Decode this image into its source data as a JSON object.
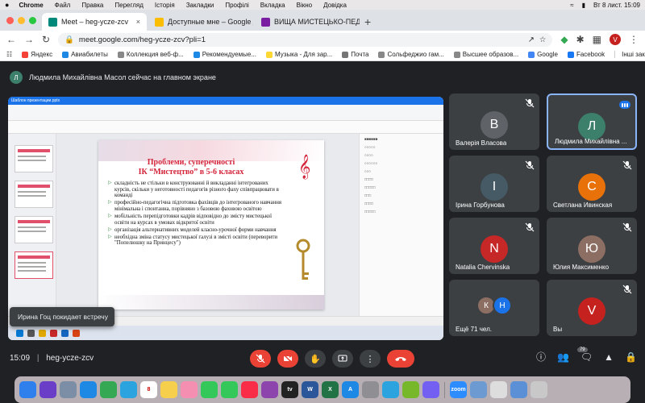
{
  "macbar": {
    "apple": "",
    "menus": [
      "Chrome",
      "Файл",
      "Правка",
      "Перегляд",
      "Історія",
      "Закладки",
      "Профілі",
      "Вкладка",
      "Вікно",
      "Довідка"
    ],
    "clock": "Вт 8 лист.  15:09"
  },
  "tabs": [
    {
      "title": "Meet – heg-ycze-zcv",
      "color": "#00897b",
      "active": true
    },
    {
      "title": "Доступные мне – Google Диск",
      "color": "#fbbc04",
      "active": false
    },
    {
      "title": "ВИЩА МИСТЕЦЬКО-ПЕДАГОГ...",
      "color": "#7b1fa2",
      "active": false
    }
  ],
  "address": {
    "url": "meet.google.com/heg-ycze-zcv?pli=1",
    "profile": "V"
  },
  "bookmarks": [
    {
      "label": "Яндекс",
      "color": "#f44336"
    },
    {
      "label": "Авиабилеты",
      "color": "#1e88e5"
    },
    {
      "label": "Коллекция веб-ф...",
      "color": "#888888"
    },
    {
      "label": "Рекомендуемые...",
      "color": "#1e88e5"
    },
    {
      "label": "Музыка - Для зар...",
      "color": "#fdd835"
    },
    {
      "label": "Почта",
      "color": "#757575"
    },
    {
      "label": "Сольфеджио гам...",
      "color": "#888888"
    },
    {
      "label": "Высшее образов...",
      "color": "#888888"
    },
    {
      "label": "Google",
      "color": "#4285f4"
    },
    {
      "label": "Facebook",
      "color": "#1877f2"
    }
  ],
  "bookmarks_other": "Інші закладки",
  "banner": {
    "initial": "Л",
    "text": "Людмила Михайлівна Масол сейчас на главном экране"
  },
  "slide": {
    "title_line1": "Проблеми, суперечності",
    "title_line2": "ІК “Мистецтво” в 5-6 класах",
    "bullets": [
      "складність не стільки в конструюванні й викладанні інтегрованих курсів, скільки у неготовності педагогів різного фаху співпрацювати в команді",
      "професійно-педагогічна підготовка фахівців до інтегрованого навчання мінімальна і спонтанна, порівняно з базовою фаховою освітою",
      "мобільність перепідготовки кадрів відповідно до змісту мистецької освіти на курсах в умовах відкритої освіти",
      "організація альтернативних моделей класно-урочної форми навчання",
      "необхідна зміна статусу мистецької галузі в змісті освіти (переворити \"Попелюшку на Принцесу\")"
    ],
    "tab_label": "Шаблон презентации.pptx"
  },
  "toast": "Ирина Гоц покидает встречу",
  "participants": [
    {
      "name": "Валерія Власова",
      "initial": "В",
      "color": "#5f6368",
      "muted": true,
      "speaking": false
    },
    {
      "name": "Людмила Михайлівна ...",
      "initial": "Л",
      "color": "#3c7f6b",
      "muted": false,
      "speaking": true
    },
    {
      "name": "Ірина Горбунова",
      "initial": "І",
      "color": "#455a64",
      "muted": true,
      "speaking": false
    },
    {
      "name": "Светлана Ивинская",
      "initial": "С",
      "color": "#e8710a",
      "muted": true,
      "speaking": false
    },
    {
      "name": "Natalia Chervinska",
      "initial": "N",
      "color": "#c62828",
      "muted": true,
      "speaking": false
    },
    {
      "name": "Юлия Максименко",
      "initial": "Ю",
      "color": "#8d6e63",
      "muted": true,
      "speaking": false
    },
    {
      "name": "Ещё 71 чел.",
      "initial": "К",
      "color": "#8d6e63",
      "muted": false,
      "speaking": false
    },
    {
      "name": "Вы",
      "initial": "V",
      "color": "#c5221f",
      "muted": true,
      "speaking": false
    }
  ],
  "more_second_initial": "Н",
  "bottom": {
    "time": "15:09",
    "separator": "|",
    "code": "heg-ycze-zcv",
    "participant_count": "79"
  },
  "dock_apps": [
    {
      "name": "finder",
      "color": "#2f80ed",
      "label": ""
    },
    {
      "name": "siri",
      "color": "#6a3ec7",
      "label": ""
    },
    {
      "name": "launchpad",
      "color": "#7c8ea6",
      "label": ""
    },
    {
      "name": "safari",
      "color": "#1e88e5",
      "label": ""
    },
    {
      "name": "chrome",
      "color": "#34a853",
      "label": ""
    },
    {
      "name": "telegram",
      "color": "#2aa3df",
      "label": ""
    },
    {
      "name": "calendar",
      "color": "#ffffff",
      "label": "8"
    },
    {
      "name": "notes",
      "color": "#f6d04d",
      "label": ""
    },
    {
      "name": "photos",
      "color": "#f48fb1",
      "label": ""
    },
    {
      "name": "facetime",
      "color": "#34c759",
      "label": ""
    },
    {
      "name": "messages",
      "color": "#34c759",
      "label": ""
    },
    {
      "name": "music",
      "color": "#fa2d48",
      "label": ""
    },
    {
      "name": "podcasts",
      "color": "#8e44ad",
      "label": ""
    },
    {
      "name": "tv",
      "color": "#222222",
      "label": "tv"
    },
    {
      "name": "word",
      "color": "#2b579a",
      "label": "W"
    },
    {
      "name": "excel",
      "color": "#217346",
      "label": "X"
    },
    {
      "name": "appstore",
      "color": "#1e88e5",
      "label": "A"
    },
    {
      "name": "settings",
      "color": "#8e8e93",
      "label": ""
    },
    {
      "name": "telegram2",
      "color": "#2aa3df",
      "label": ""
    },
    {
      "name": "torrent",
      "color": "#76b82a",
      "label": ""
    },
    {
      "name": "viber",
      "color": "#7360f2",
      "label": ""
    },
    {
      "name": "zoom",
      "color": "#2d8cff",
      "label": "zoom"
    },
    {
      "name": "preview",
      "color": "#6d9bd1",
      "label": ""
    },
    {
      "name": "files",
      "color": "#dddddd",
      "label": ""
    },
    {
      "name": "downloads",
      "color": "#5b8fd6",
      "label": ""
    },
    {
      "name": "trash",
      "color": "#c8c8c8",
      "label": ""
    }
  ],
  "colors": {
    "meet_bg": "#202124",
    "tile_bg": "#3c4043",
    "accent_red": "#ea4335",
    "speaking_border": "#8ab4f8"
  }
}
